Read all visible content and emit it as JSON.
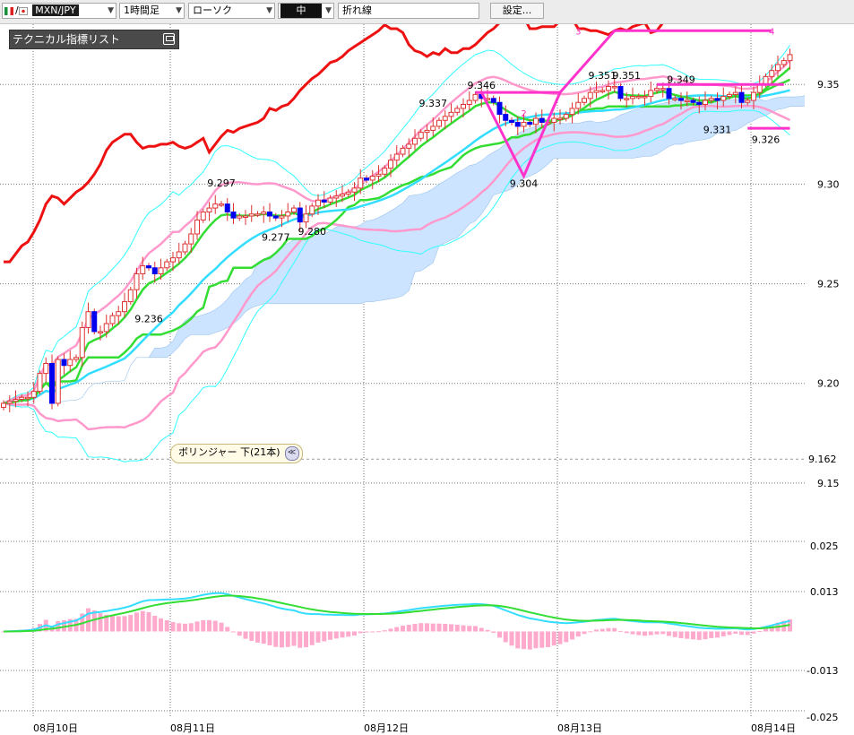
{
  "toolbar": {
    "symbol": "MXN/JPY",
    "timeframe": "1時間足",
    "chart_type": "ローソク",
    "size": "中",
    "line_type": "折れ線",
    "settings_label": "設定..."
  },
  "legend": {
    "title": "テクニカル指標リスト"
  },
  "tooltip": {
    "text": "ボリンジャー 下(21本)"
  },
  "colors": {
    "bollinger": "#ff99cc",
    "bollinger_outer": "#33ffff",
    "cloud": "#cce4ff",
    "tenkan": "#33dd33",
    "kijun": "#33ddff",
    "chikou": "#ee1111",
    "pattern": "#ff33cc",
    "bear": "#0000ee",
    "macd": "#33ddff",
    "signal": "#33dd33",
    "hist": "#ffaacc"
  },
  "chart_data": [
    {
      "type": "candlestick",
      "ylim": [
        9.145,
        9.378
      ],
      "price_ticks": [
        "9.35",
        "9.30",
        "9.25",
        "9.20",
        "9.15"
      ],
      "current_level": "9.162",
      "date_labels": [
        "08月10日",
        "08月11日",
        "08月12日",
        "08月13日",
        "08月14日"
      ],
      "close": [
        9.19,
        9.191,
        9.192,
        9.193,
        9.193,
        9.196,
        9.205,
        9.21,
        9.19,
        9.212,
        9.209,
        9.212,
        9.213,
        9.228,
        9.236,
        9.226,
        9.226,
        9.23,
        9.234,
        9.236,
        9.241,
        9.247,
        9.255,
        9.259,
        9.258,
        9.255,
        9.258,
        9.261,
        9.263,
        9.266,
        9.27,
        9.275,
        9.282,
        9.286,
        9.288,
        9.29,
        9.29,
        9.286,
        9.283,
        9.284,
        9.284,
        9.285,
        9.285,
        9.286,
        9.284,
        9.283,
        9.284,
        9.286,
        9.288,
        9.281,
        9.285,
        9.289,
        9.292,
        9.291,
        9.293,
        9.294,
        9.295,
        9.296,
        9.298,
        9.303,
        9.302,
        9.304,
        9.305,
        9.308,
        9.312,
        9.315,
        9.318,
        9.32,
        9.323,
        9.326,
        9.327,
        9.329,
        9.332,
        9.334,
        9.336,
        9.338,
        9.34,
        9.342,
        9.345,
        9.343,
        9.343,
        9.341,
        9.335,
        9.332,
        9.331,
        9.329,
        9.331,
        9.33,
        9.333,
        9.331,
        9.331,
        9.333,
        9.333,
        9.335,
        9.338,
        9.341,
        9.343,
        9.346,
        9.347,
        9.347,
        9.349,
        9.349,
        9.343,
        9.343,
        9.344,
        9.344,
        9.344,
        9.347,
        9.348,
        9.348,
        9.343,
        9.343,
        9.342,
        9.342,
        9.341,
        9.34,
        9.342,
        9.343,
        9.342,
        9.344,
        9.345,
        9.346,
        9.341,
        9.342,
        9.346,
        9.35,
        9.354,
        9.357,
        9.36,
        9.362,
        9.365
      ],
      "annotations": [
        {
          "label": "9.236",
          "at": 24
        },
        {
          "label": "9.297",
          "at": 36
        },
        {
          "label": "9.277",
          "at": 45
        },
        {
          "label": "9.280",
          "at": 51
        },
        {
          "label": "9.337",
          "at": 71
        },
        {
          "label": "9.346",
          "at": 79
        },
        {
          "label": "9.304",
          "at": 86
        },
        {
          "label": "9.351",
          "at": 99
        },
        {
          "label": "9.351",
          "at": 103
        },
        {
          "label": "9.349",
          "at": 112
        },
        {
          "label": "9.331",
          "at": 118
        },
        {
          "label": "9.326",
          "at": 126
        }
      ],
      "wave_labels": [
        "2",
        "3",
        "4"
      ]
    },
    {
      "type": "line",
      "ylim": [
        -0.025,
        0.025
      ],
      "ticks": [
        "0.025",
        "0.013",
        "-0.013",
        "-0.025"
      ]
    }
  ]
}
